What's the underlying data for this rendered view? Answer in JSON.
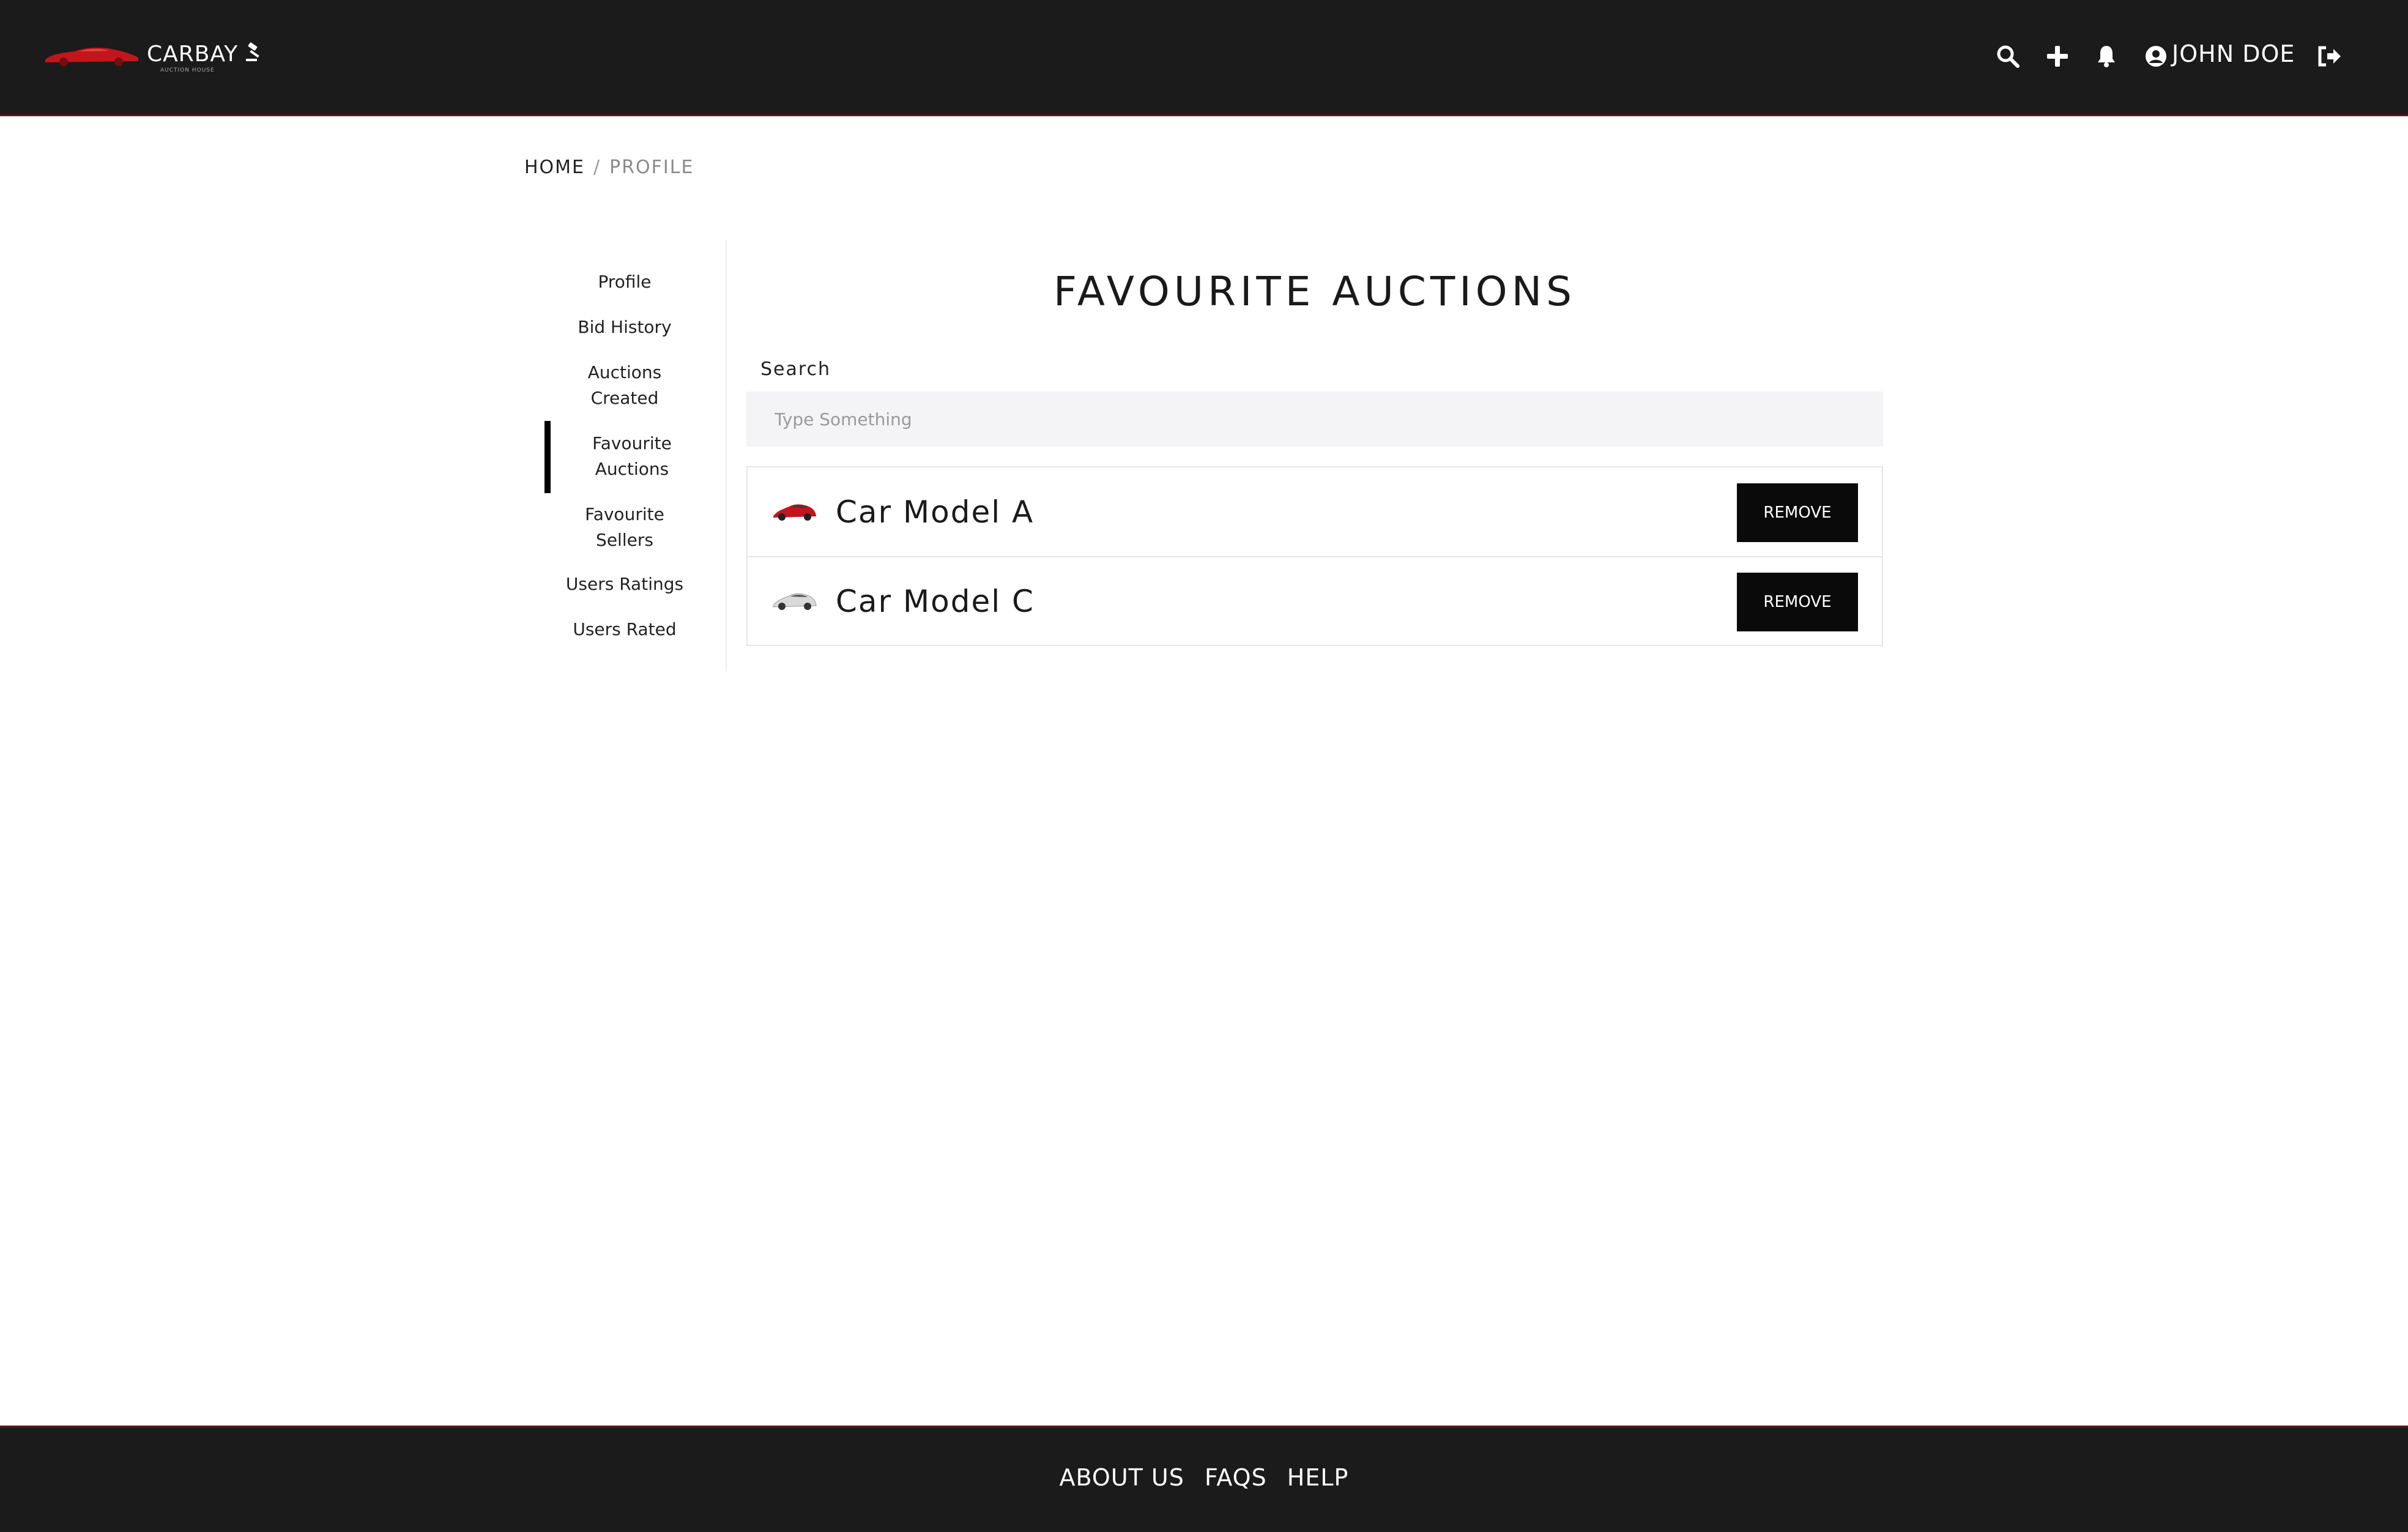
{
  "header": {
    "brand": "CARBAY",
    "brand_subtitle": "AUCTION HOUSE",
    "user_name": "JOHN DOE",
    "icons": [
      "search-icon",
      "plus-icon",
      "bell-icon",
      "user-circle-icon",
      "logout-icon"
    ]
  },
  "breadcrumb": {
    "home": "HOME",
    "separator": "/",
    "current": "PROFILE"
  },
  "sidebar": {
    "items": [
      {
        "label": "Profile"
      },
      {
        "label": "Bid History"
      },
      {
        "label": "Auctions Created"
      },
      {
        "label": "Favourite Auctions",
        "active": true
      },
      {
        "label": "Favourite Sellers"
      },
      {
        "label": "Users Ratings"
      },
      {
        "label": "Users Rated"
      }
    ]
  },
  "main": {
    "title": "FAVOURITE AUCTIONS",
    "search_label": "Search",
    "search_placeholder": "Type Something",
    "search_value": "",
    "items": [
      {
        "name": "Car Model A",
        "thumb_color": "#c0161c",
        "action": "REMOVE"
      },
      {
        "name": "Car Model C",
        "thumb_color": "#d9d9d9",
        "action": "REMOVE"
      }
    ]
  },
  "footer": {
    "links": [
      "ABOUT US",
      "FAQS",
      "HELP"
    ]
  },
  "colors": {
    "bar_background": "#1b1b1b",
    "accent_red": "#c0161c",
    "button_dark": "#0a0a0a"
  }
}
